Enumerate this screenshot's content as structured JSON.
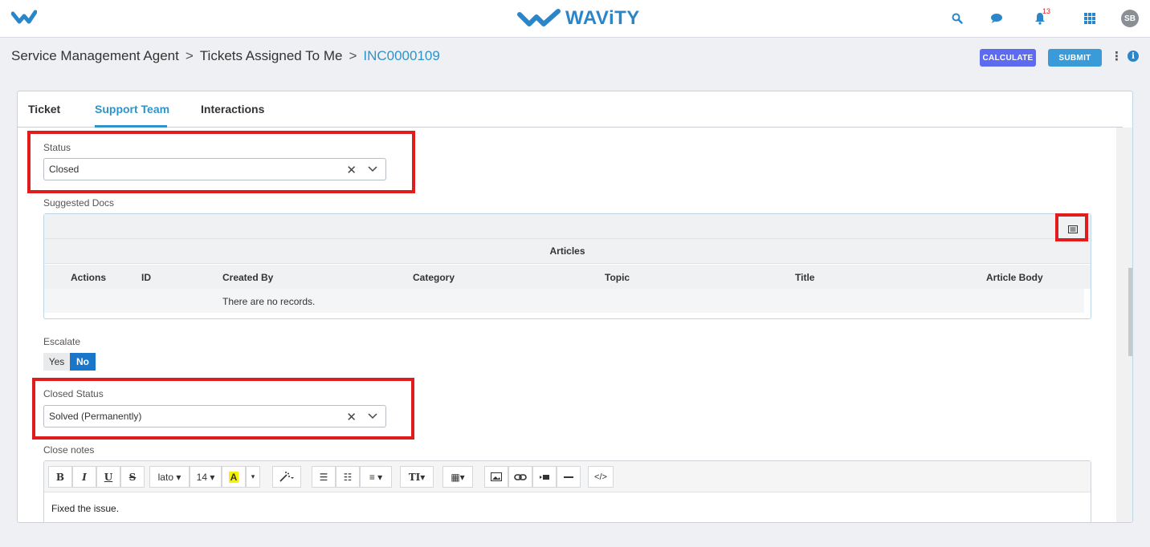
{
  "header": {
    "brand": "WAViTY",
    "notification_count": "13",
    "avatar_initials": "SB",
    "accent_color": "#2b86c9",
    "icons": [
      "search-icon",
      "chat-icon",
      "bell-icon",
      "apps-grid-icon"
    ]
  },
  "breadcrumb": {
    "items": [
      "Service Management Agent",
      "Tickets Assigned To Me",
      "INC0000109"
    ],
    "separator": ">"
  },
  "actions": {
    "calculate_label": "CALCULATE",
    "submit_label": "SUBMIT",
    "more_label": "⋮",
    "info_label": "i"
  },
  "tabs": [
    {
      "label": "Ticket",
      "active": false
    },
    {
      "label": "Support Team",
      "active": true
    },
    {
      "label": "Interactions",
      "active": false
    }
  ],
  "form": {
    "status": {
      "label": "Status",
      "value": "Closed",
      "clear": "✕"
    },
    "suggested_docs": {
      "label": "Suggested Docs",
      "table_title": "Articles",
      "columns": [
        "Actions",
        "ID",
        "Created By",
        "Category",
        "Topic",
        "Title",
        "Article Body"
      ],
      "empty_text": "There are no records."
    },
    "escalate": {
      "label": "Escalate",
      "options": [
        "Yes",
        "No"
      ],
      "selected": "No"
    },
    "closed_status": {
      "label": "Closed Status",
      "value": "Solved (Permanently)",
      "clear": "✕"
    },
    "close_notes": {
      "label": "Close notes",
      "content": "Fixed the issue.",
      "toolbar": {
        "bold": "B",
        "italic": "I",
        "underline": "U",
        "strike": "S",
        "font": "lato ▾",
        "size": "14 ▾",
        "color": "A",
        "color_caret": "▾",
        "magic": "⁘▾",
        "ul": "☰",
        "ol": "☷",
        "align": "≡ ▾",
        "text_style": "TI▾",
        "table": "▦▾",
        "code": "</>"
      }
    }
  }
}
